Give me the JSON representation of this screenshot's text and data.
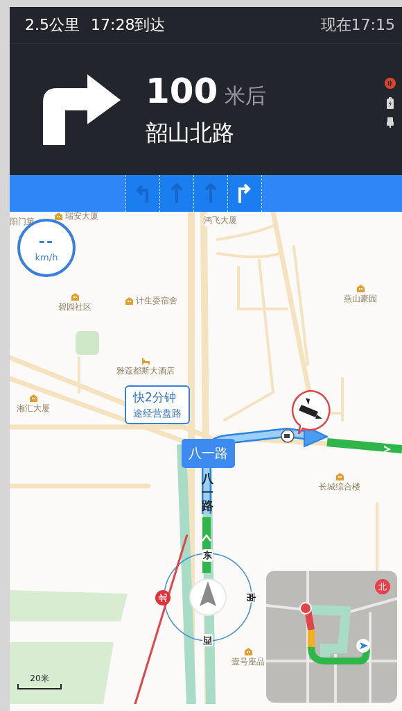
{
  "status": {
    "distance": "2.5公里",
    "arrival": "17:28到达",
    "now": "现在17:15"
  },
  "maneuver": {
    "kind": "right",
    "distance": "100",
    "unit": "米后",
    "road": "韶山北路"
  },
  "indicators": [
    {
      "kind": "gps"
    },
    {
      "kind": "battery"
    },
    {
      "kind": "usb"
    }
  ],
  "lanes": [
    {
      "kind": "left",
      "selected": false
    },
    {
      "kind": "straight",
      "selected": false
    },
    {
      "kind": "straight",
      "selected": false
    },
    {
      "kind": "right",
      "selected": true
    }
  ],
  "speed": {
    "value": "--",
    "unit": "km/h"
  },
  "map_labels": [
    {
      "text": "阳门第",
      "kind": "none"
    },
    {
      "text": "瑞安大厦",
      "kind": "building"
    },
    {
      "text": "鸿飞大厦",
      "kind": "none"
    },
    {
      "text": "碧园社区",
      "kind": "building"
    },
    {
      "text": "计生委宿舍",
      "kind": "building"
    },
    {
      "text": "燕山豪园",
      "kind": "building"
    },
    {
      "text": "雅蔻都斯大酒店",
      "kind": "hotel"
    },
    {
      "text": "湘汇大厦",
      "kind": "building"
    },
    {
      "text": "长城综合楼",
      "kind": "building"
    },
    {
      "text": "壹号座品",
      "kind": "building"
    }
  ],
  "route_bubble": {
    "title": "快2分钟",
    "subtitle": "途经营盘路"
  },
  "road_sign": "八一路",
  "road_name": [
    "八",
    "一",
    "路"
  ],
  "compass": {
    "top": "东",
    "right": "南",
    "bottom": "西",
    "left": "北"
  },
  "minimap": {
    "north": "北"
  },
  "scale": "20米"
}
